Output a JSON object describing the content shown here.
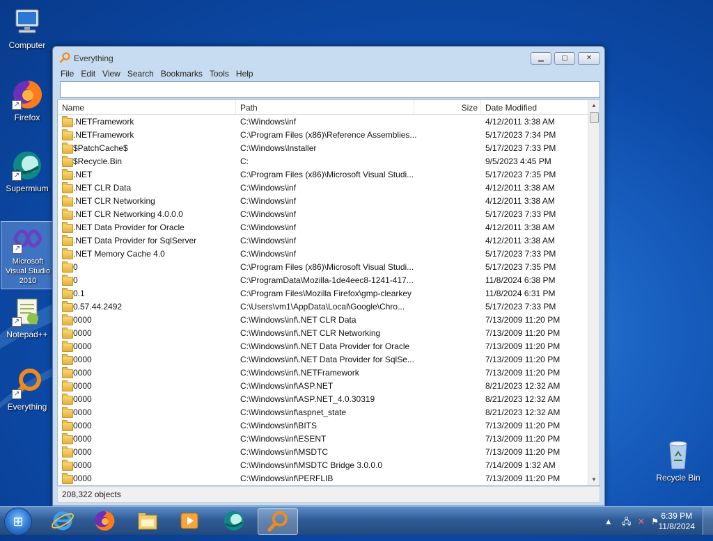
{
  "desktop": {
    "icons": [
      {
        "label": "Computer",
        "icon": "computer-icon"
      },
      {
        "label": "Firefox",
        "icon": "firefox-icon"
      },
      {
        "label": "Supermium",
        "icon": "supermium-icon"
      },
      {
        "label": "Microsoft Visual Studio 2010",
        "icon": "visual-studio-icon"
      },
      {
        "label": "Notepad++",
        "icon": "notepadpp-icon"
      },
      {
        "label": "Everything",
        "icon": "everything-icon"
      },
      {
        "label": "Recycle Bin",
        "icon": "recycle-bin-icon"
      }
    ]
  },
  "window": {
    "title": "Everything",
    "menu": [
      "File",
      "Edit",
      "View",
      "Search",
      "Bookmarks",
      "Tools",
      "Help"
    ],
    "search": {
      "value": "",
      "placeholder": ""
    },
    "columns": [
      "Name",
      "Path",
      "Size",
      "Date Modified"
    ],
    "rows": [
      {
        "name": ".NETFramework",
        "path": "C:\\Windows\\inf",
        "date": "4/12/2011 3:38 AM"
      },
      {
        "name": ".NETFramework",
        "path": "C:\\Program Files (x86)\\Reference Assemblies...",
        "date": "5/17/2023 7:34 PM"
      },
      {
        "name": "$PatchCache$",
        "path": "C:\\Windows\\Installer",
        "date": "5/17/2023 7:33 PM"
      },
      {
        "name": "$Recycle.Bin",
        "path": "C:",
        "date": "9/5/2023 4:45 PM"
      },
      {
        "name": ".NET",
        "path": "C:\\Program Files (x86)\\Microsoft Visual Studi...",
        "date": "5/17/2023 7:35 PM"
      },
      {
        "name": ".NET CLR Data",
        "path": "C:\\Windows\\inf",
        "date": "4/12/2011 3:38 AM"
      },
      {
        "name": ".NET CLR Networking",
        "path": "C:\\Windows\\inf",
        "date": "4/12/2011 3:38 AM"
      },
      {
        "name": ".NET CLR Networking 4.0.0.0",
        "path": "C:\\Windows\\inf",
        "date": "5/17/2023 7:33 PM"
      },
      {
        "name": ".NET Data Provider for Oracle",
        "path": "C:\\Windows\\inf",
        "date": "4/12/2011 3:38 AM"
      },
      {
        "name": ".NET Data Provider for SqlServer",
        "path": "C:\\Windows\\inf",
        "date": "4/12/2011 3:38 AM"
      },
      {
        "name": ".NET Memory Cache 4.0",
        "path": "C:\\Windows\\inf",
        "date": "5/17/2023 7:33 PM"
      },
      {
        "name": "0",
        "path": "C:\\Program Files (x86)\\Microsoft Visual Studi...",
        "date": "5/17/2023 7:35 PM"
      },
      {
        "name": "0",
        "path": "C:\\ProgramData\\Mozilla-1de4eec8-1241-417...",
        "date": "11/8/2024 6:38 PM"
      },
      {
        "name": "0.1",
        "path": "C:\\Program Files\\Mozilla Firefox\\gmp-clearkey",
        "date": "11/8/2024 6:31 PM"
      },
      {
        "name": "0.57.44.2492",
        "path": "C:\\Users\\vm1\\AppData\\Local\\Google\\Chro...",
        "date": "5/17/2023 7:33 PM"
      },
      {
        "name": "0000",
        "path": "C:\\Windows\\inf\\.NET CLR Data",
        "date": "7/13/2009 11:20 PM"
      },
      {
        "name": "0000",
        "path": "C:\\Windows\\inf\\.NET CLR Networking",
        "date": "7/13/2009 11:20 PM"
      },
      {
        "name": "0000",
        "path": "C:\\Windows\\inf\\.NET Data Provider for Oracle",
        "date": "7/13/2009 11:20 PM"
      },
      {
        "name": "0000",
        "path": "C:\\Windows\\inf\\.NET Data Provider for SqlSe...",
        "date": "7/13/2009 11:20 PM"
      },
      {
        "name": "0000",
        "path": "C:\\Windows\\inf\\.NETFramework",
        "date": "7/13/2009 11:20 PM"
      },
      {
        "name": "0000",
        "path": "C:\\Windows\\inf\\ASP.NET",
        "date": "8/21/2023 12:32 AM"
      },
      {
        "name": "0000",
        "path": "C:\\Windows\\inf\\ASP.NET_4.0.30319",
        "date": "8/21/2023 12:32 AM"
      },
      {
        "name": "0000",
        "path": "C:\\Windows\\inf\\aspnet_state",
        "date": "8/21/2023 12:32 AM"
      },
      {
        "name": "0000",
        "path": "C:\\Windows\\inf\\BITS",
        "date": "7/13/2009 11:20 PM"
      },
      {
        "name": "0000",
        "path": "C:\\Windows\\inf\\ESENT",
        "date": "7/13/2009 11:20 PM"
      },
      {
        "name": "0000",
        "path": "C:\\Windows\\inf\\MSDTC",
        "date": "7/13/2009 11:20 PM"
      },
      {
        "name": "0000",
        "path": "C:\\Windows\\inf\\MSDTC Bridge 3.0.0.0",
        "date": "7/14/2009 1:32 AM"
      },
      {
        "name": "0000",
        "path": "C:\\Windows\\inf\\PERFLIB",
        "date": "7/13/2009 11:20 PM"
      }
    ],
    "status": "208,322 objects"
  },
  "taskbar": {
    "items": [
      "internet-explorer-icon",
      "firefox-icon",
      "file-explorer-icon",
      "media-player-icon",
      "supermium-icon",
      "everything-icon"
    ],
    "clock_time": "6:39 PM",
    "clock_date": "11/8/2024"
  },
  "colors": {
    "accent": "#1b63c4",
    "folder": "#e4b03a"
  }
}
